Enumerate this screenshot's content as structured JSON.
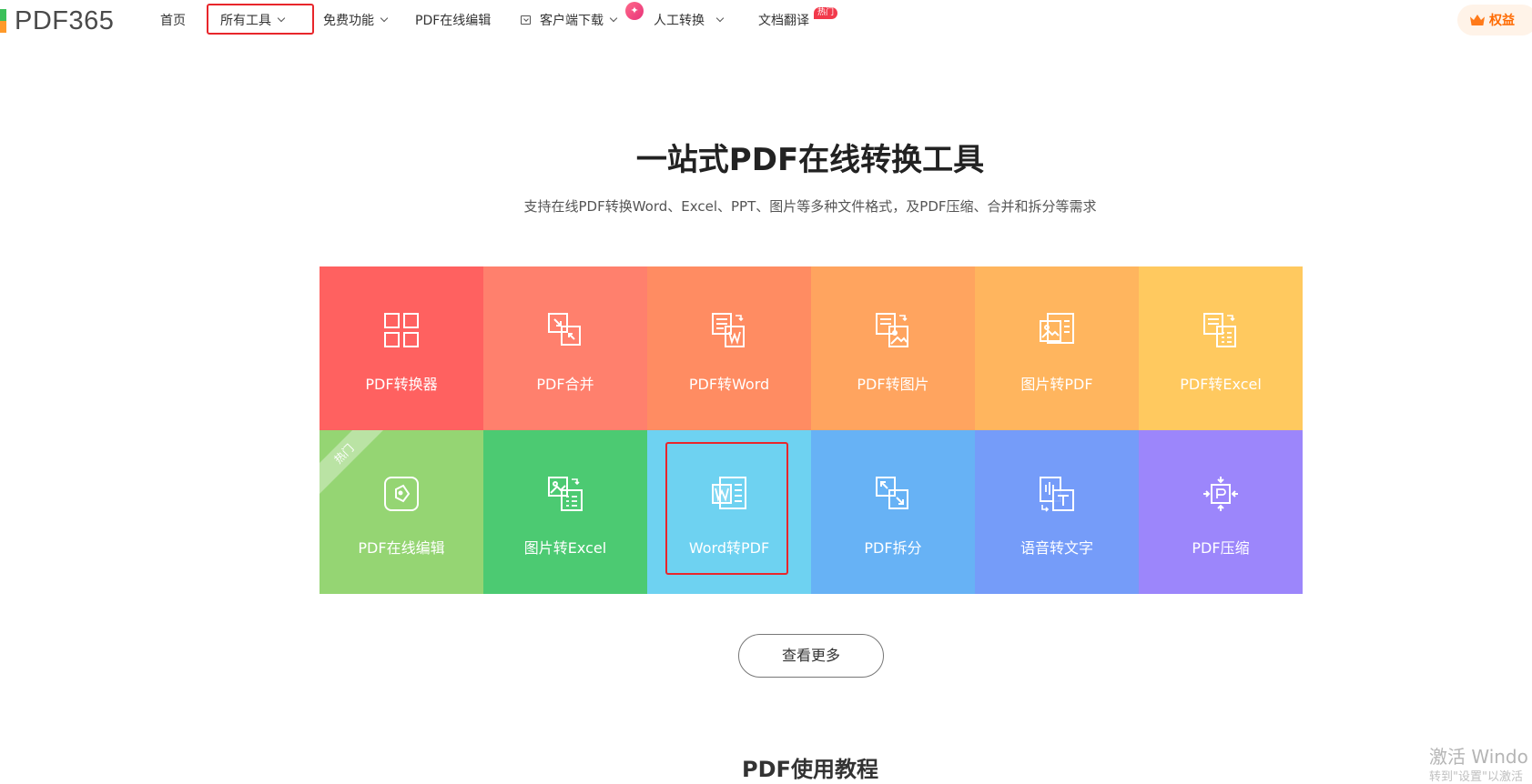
{
  "header": {
    "logo_text": "PDF365",
    "nav": [
      {
        "label": "首页"
      },
      {
        "label": "所有工具"
      },
      {
        "label": "免费功能"
      },
      {
        "label": "PDF在线编辑"
      },
      {
        "label": "客户端下载"
      },
      {
        "label": "人工转换"
      },
      {
        "label": "文档翻译"
      }
    ],
    "hot_badge": "热门",
    "benefits_label": "权益"
  },
  "hero": {
    "title": "一站式PDF在线转换工具",
    "subtitle": "支持在线PDF转换Word、Excel、PPT、图片等多种文件格式，及PDF压缩、合并和拆分等需求"
  },
  "tools": [
    {
      "label": "PDF转换器",
      "color": "#ff6160",
      "icon": "grid-icon"
    },
    {
      "label": "PDF合并",
      "color": "#ff806d",
      "icon": "merge-icon"
    },
    {
      "label": "PDF转Word",
      "color": "#ff8c62",
      "icon": "pdf-to-word-icon"
    },
    {
      "label": "PDF转图片",
      "color": "#ffa45f",
      "icon": "pdf-to-image-icon"
    },
    {
      "label": "图片转PDF",
      "color": "#ffb55e",
      "icon": "image-to-pdf-icon"
    },
    {
      "label": "PDF转Excel",
      "color": "#ffc95f",
      "icon": "pdf-to-excel-icon"
    },
    {
      "label": "PDF在线编辑",
      "color": "#95d573",
      "icon": "edit-icon",
      "ribbon": "热门"
    },
    {
      "label": "图片转Excel",
      "color": "#4cca72",
      "icon": "image-to-excel-icon"
    },
    {
      "label": "Word转PDF",
      "color": "#6ed2f1",
      "icon": "word-to-pdf-icon"
    },
    {
      "label": "PDF拆分",
      "color": "#67b2f5",
      "icon": "split-icon"
    },
    {
      "label": "语音转文字",
      "color": "#759cf9",
      "icon": "voice-to-text-icon"
    },
    {
      "label": "PDF压缩",
      "color": "#9c86fb",
      "icon": "compress-icon"
    }
  ],
  "more_button": "查看更多",
  "tutorial_title": "PDF使用教程",
  "watermark": {
    "line1": "激活 Windo",
    "line2": "转到\"设置\"以激活"
  }
}
